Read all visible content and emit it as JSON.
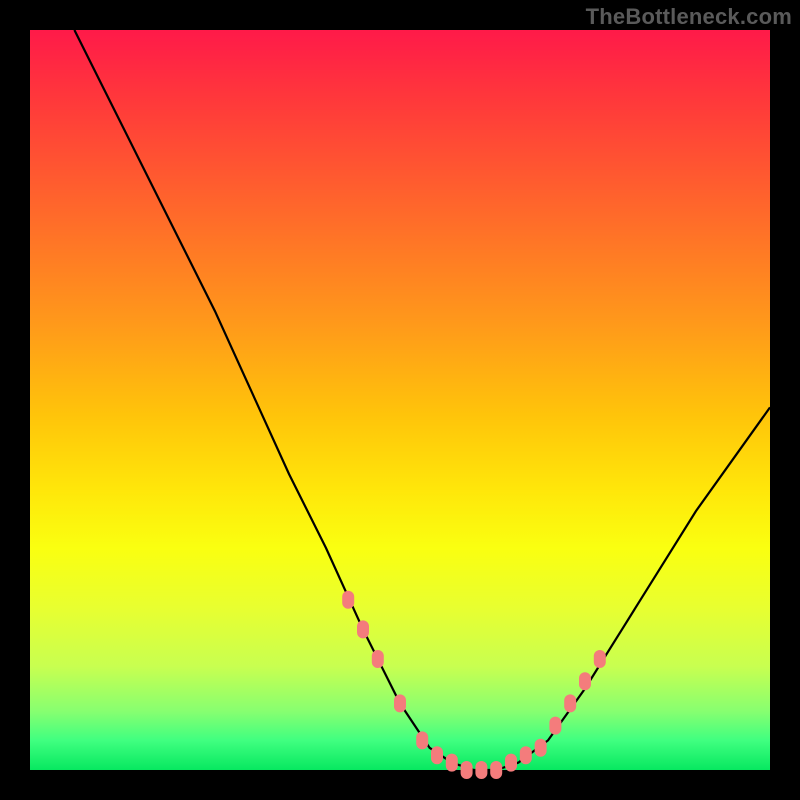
{
  "watermark": "TheBottleneck.com",
  "colors": {
    "frame": "#000000",
    "curve": "#000000",
    "markers": "#f47c7c",
    "gradient_top": "#ff1a49",
    "gradient_bottom": "#07e860"
  },
  "chart_data": {
    "type": "line",
    "title": "",
    "xlabel": "",
    "ylabel": "",
    "xlim": [
      0,
      100
    ],
    "ylim": [
      0,
      100
    ],
    "grid": false,
    "legend": false,
    "series": [
      {
        "name": "bottleneck-curve",
        "x": [
          6,
          10,
          15,
          20,
          25,
          30,
          35,
          40,
          45,
          50,
          54,
          57,
          60,
          63,
          66,
          70,
          75,
          80,
          85,
          90,
          95,
          100
        ],
        "y": [
          100,
          92,
          82,
          72,
          62,
          51,
          40,
          30,
          19,
          9,
          3,
          1,
          0,
          0,
          1,
          4,
          11,
          19,
          27,
          35,
          42,
          49
        ]
      }
    ],
    "markers": {
      "name": "highlight-dots",
      "x": [
        43,
        45,
        47,
        50,
        53,
        55,
        57,
        59,
        61,
        63,
        65,
        67,
        69,
        71,
        73,
        75,
        77
      ],
      "y": [
        23,
        19,
        15,
        9,
        4,
        2,
        1,
        0,
        0,
        0,
        1,
        2,
        3,
        6,
        9,
        12,
        15
      ]
    }
  }
}
